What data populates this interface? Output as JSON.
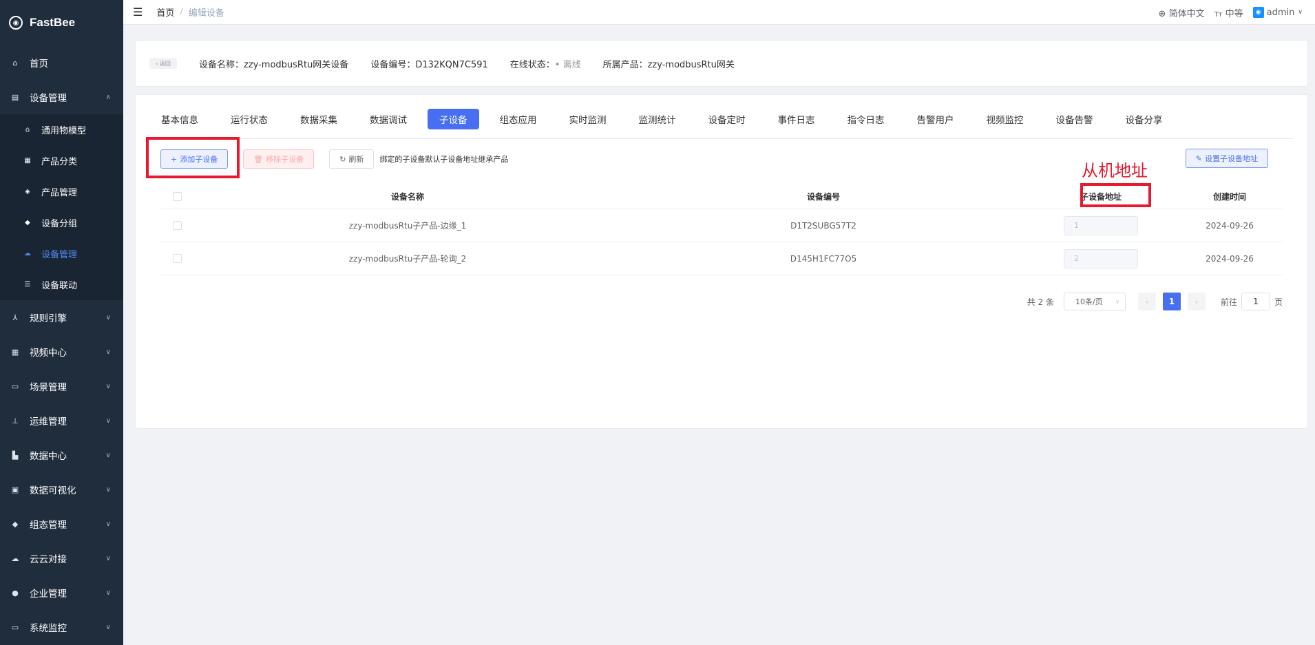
{
  "app": {
    "name": "FastBee"
  },
  "sidebar": {
    "menu": [
      {
        "label": "首页",
        "icon": "home-icon",
        "glyph": "⌂"
      },
      {
        "label": "设备管理",
        "icon": "device-icon",
        "glyph": "▤",
        "expanded": true
      }
    ],
    "submenu": [
      {
        "label": "通用物模型",
        "icon": "model-icon",
        "glyph": "⌂"
      },
      {
        "label": "产品分类",
        "icon": "category-icon",
        "glyph": "▦"
      },
      {
        "label": "产品管理",
        "icon": "product-icon",
        "glyph": "◈"
      },
      {
        "label": "设备分组",
        "icon": "group-icon",
        "glyph": "◆"
      },
      {
        "label": "设备管理",
        "icon": "device-manage-icon",
        "glyph": "☁",
        "active": true
      },
      {
        "label": "设备联动",
        "icon": "linkage-icon",
        "glyph": "☰"
      }
    ],
    "menu_after": [
      {
        "label": "规则引擎",
        "icon": "rule-icon",
        "glyph": "⅄"
      },
      {
        "label": "视频中心",
        "icon": "video-icon",
        "glyph": "▦"
      },
      {
        "label": "场景管理",
        "icon": "scene-icon",
        "glyph": "▭"
      },
      {
        "label": "运维管理",
        "icon": "ops-icon",
        "glyph": "⊥"
      },
      {
        "label": "数据中心",
        "icon": "data-center-icon",
        "glyph": "▙"
      },
      {
        "label": "数据可视化",
        "icon": "visual-icon",
        "glyph": "▣"
      },
      {
        "label": "组态管理",
        "icon": "config-icon",
        "glyph": "◆"
      },
      {
        "label": "云云对接",
        "icon": "cloud-icon",
        "glyph": "☁"
      },
      {
        "label": "企业管理",
        "icon": "enterprise-icon",
        "glyph": "●"
      },
      {
        "label": "系统监控",
        "icon": "monitor-icon",
        "glyph": "▭"
      }
    ]
  },
  "navbar": {
    "breadcrumb": {
      "home": "首页",
      "separator": "/",
      "current": "编辑设备"
    },
    "language": "简体中文",
    "font_size": "中等",
    "user": "admin"
  },
  "device_info": {
    "back": "返回",
    "name": "设备名称：zzy-modbusRtu网关设备",
    "code": "设备编号：D132KQN7C591",
    "status_label": "在线状态：",
    "status_value": "• 离线",
    "product": "所属产品：zzy-modbusRtu网关"
  },
  "tabs": [
    "基本信息",
    "运行状态",
    "数据采集",
    "数据调试",
    "子设备",
    "组态应用",
    "实时监测",
    "监测统计",
    "设备定时",
    "事件日志",
    "指令日志",
    "告警用户",
    "视频监控",
    "设备告警",
    "设备分享"
  ],
  "active_tab": "子设备",
  "toolbar": {
    "add": "添加子设备",
    "remove": "移除子设备",
    "refresh": "刷新",
    "tip": "绑定的子设备默认子设备地址继承产品",
    "set_address": "设置子设备地址"
  },
  "annotation": {
    "label": "从机地址"
  },
  "table": {
    "headers": {
      "name": "设备名称",
      "code": "设备编号",
      "address": "子设备地址",
      "created": "创建时间"
    },
    "rows": [
      {
        "name": "zzy-modbusRtu子产品-边缘_1",
        "code": "D1T2SUBG57T2",
        "address": "1",
        "created": "2024-09-26"
      },
      {
        "name": "zzy-modbusRtu子产品-轮询_2",
        "code": "D145H1FC77O5",
        "address": "2",
        "created": "2024-09-26"
      }
    ]
  },
  "pagination": {
    "total": "共 2 条",
    "page_size": "10条/页",
    "current_page": "1",
    "goto_prefix": "前往",
    "goto_value": "1",
    "goto_suffix": "页"
  },
  "colors": {
    "sidebar": "#1f2d3d",
    "primary": "#486ff2",
    "highlight": "#e8182d"
  }
}
